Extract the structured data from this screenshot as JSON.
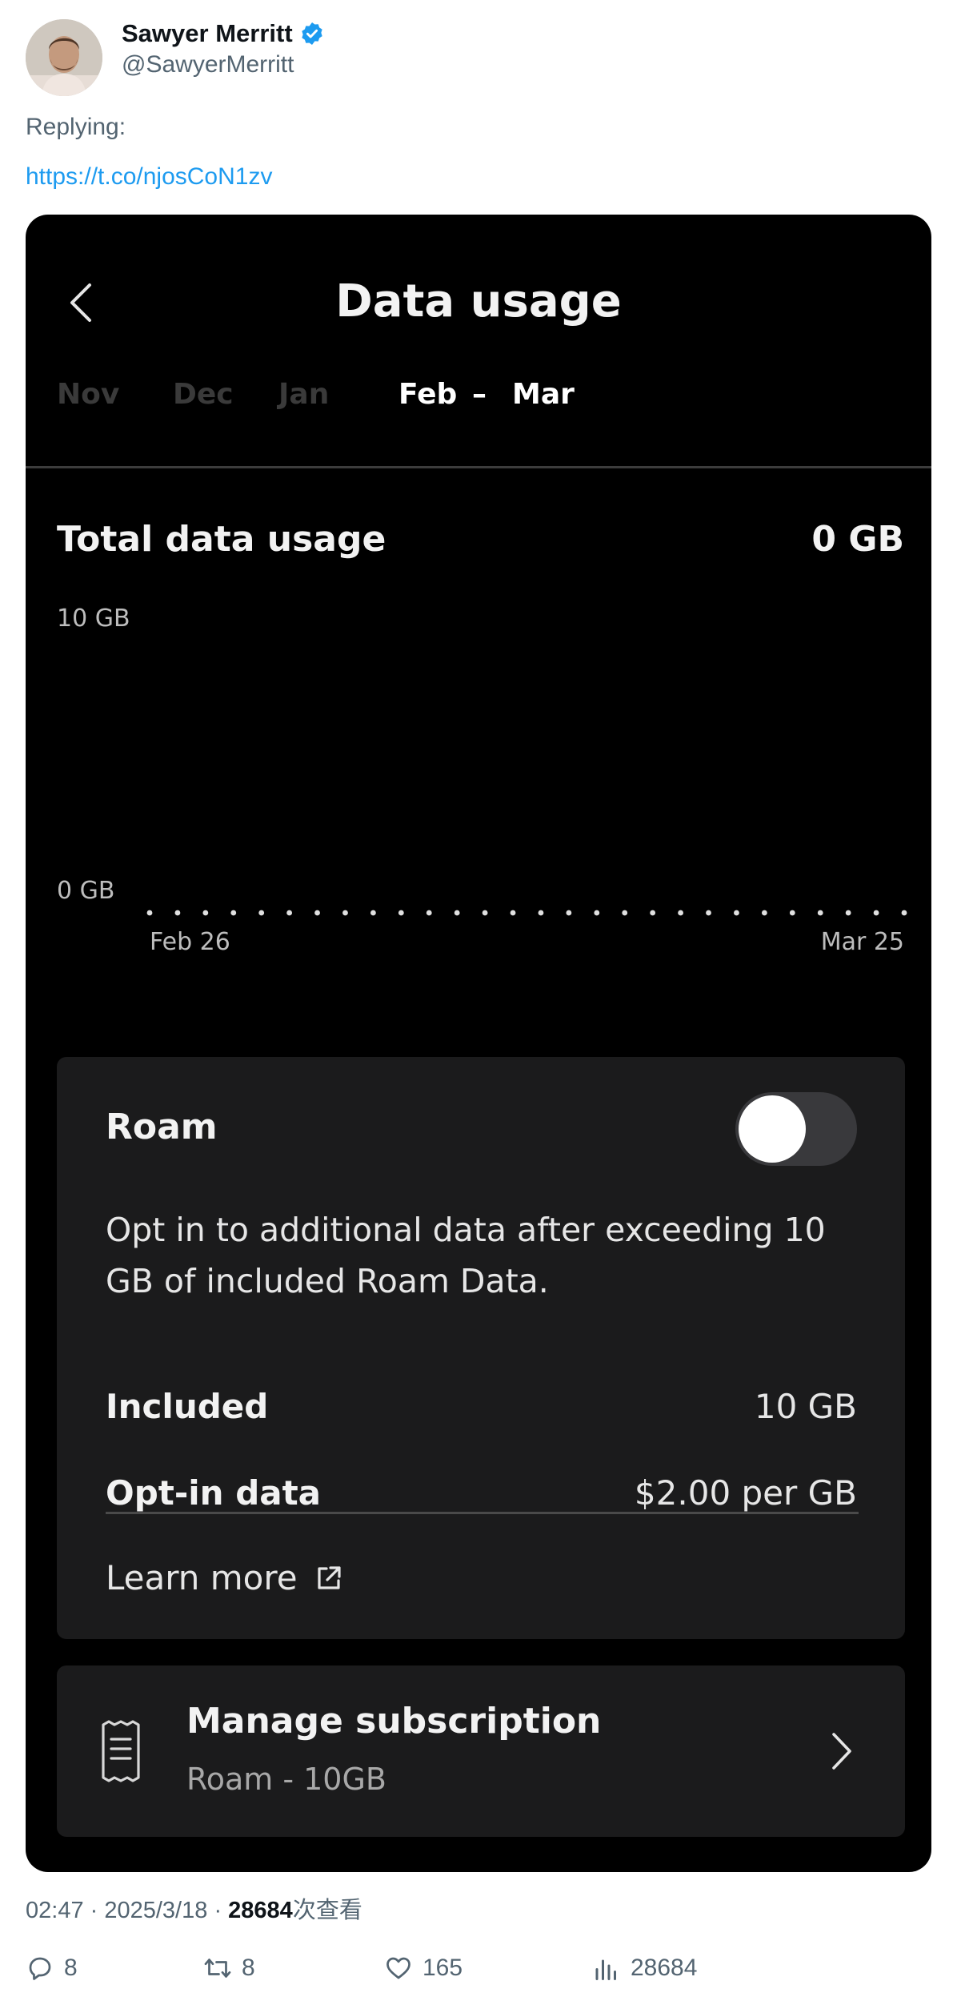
{
  "author": {
    "name": "Sawyer Merritt",
    "handle": "@SawyerMerritt",
    "verified": true
  },
  "reply": {
    "label": "Replying:",
    "link": "https://t.co/njosCoN1zv"
  },
  "screenshot": {
    "title": "Data usage",
    "months": [
      "Nov",
      "Dec",
      "Jan",
      "Feb",
      "–",
      "Mar"
    ],
    "active_months": [
      "Feb",
      "–",
      "Mar"
    ],
    "total_label": "Total data usage",
    "total_value": "0 GB",
    "chart_data": {
      "type": "line",
      "title": "",
      "xlabel": "",
      "ylabel": "",
      "y_tick_labels": [
        "10 GB",
        "0 GB"
      ],
      "x_tick_labels": [
        "Feb 26",
        "Mar 25"
      ],
      "ylim": [
        0,
        10
      ],
      "y_unit": "GB",
      "series": [
        {
          "values": [
            0,
            0,
            0,
            0,
            0,
            0,
            0,
            0,
            0,
            0,
            0,
            0,
            0,
            0,
            0,
            0,
            0,
            0,
            0,
            0,
            0,
            0,
            0,
            0,
            0,
            0,
            0,
            0
          ]
        }
      ],
      "point_style": "dotted",
      "grid": false
    },
    "roam": {
      "title": "Roam",
      "toggle_on": false,
      "description": "Opt in to additional data after exceeding 10 GB of included Roam Data.",
      "included_label": "Included",
      "included_value": "10 GB",
      "optin_label": "Opt-in data",
      "optin_value": "$2.00 per GB",
      "learn_more": "Learn more"
    },
    "subscription": {
      "title": "Manage subscription",
      "subtitle": "Roam - 10GB"
    }
  },
  "tweet_meta": {
    "time": "02:47",
    "date": "2025/3/18",
    "views_count": "28684",
    "views_suffix": "次查看"
  },
  "actions": {
    "replies": "8",
    "retweets": "8",
    "likes": "165",
    "views": "28684"
  },
  "colors": {
    "link": "#1d9bf0",
    "muted": "#536471",
    "card_bg": "#1b1b1c",
    "screen_bg": "#000000"
  }
}
